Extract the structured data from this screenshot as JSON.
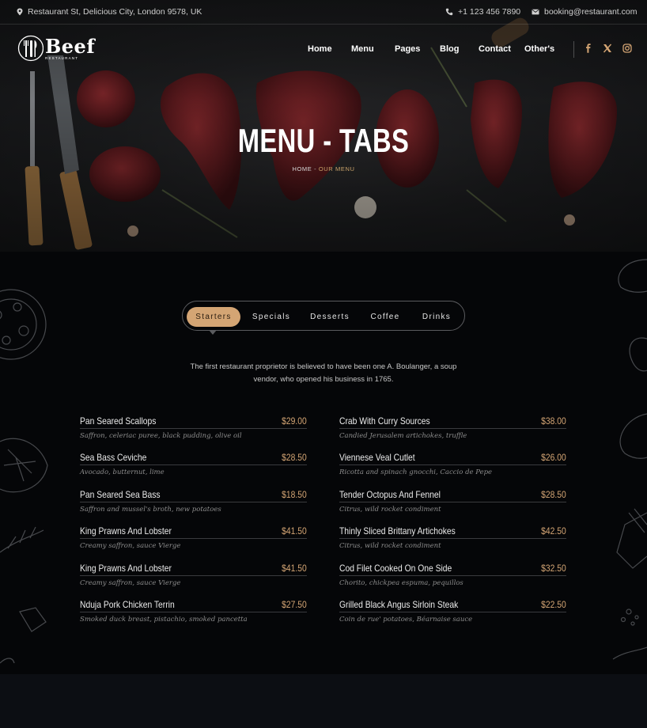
{
  "topbar": {
    "address": "Restaurant St, Delicious City, London 9578, UK",
    "phone": "+1 123 456 7890",
    "email": "booking@restaurant.com",
    "icons": [
      "map-pin-icon",
      "phone-icon",
      "envelope-icon"
    ]
  },
  "logo": {
    "name": "Beef",
    "tagline": "RESTAURANT"
  },
  "nav": {
    "items": [
      "Home",
      "Menu",
      "Pages",
      "Blog",
      "Contact",
      "Other's"
    ]
  },
  "social": {
    "icons": [
      "facebook-icon",
      "x-twitter-icon",
      "instagram-icon"
    ]
  },
  "hero": {
    "title": "MENU - TABS",
    "breadcrumb_home": "HOME",
    "breadcrumb_sep": " - ",
    "breadcrumb_current": "OUR MENU"
  },
  "tabs": {
    "items": [
      "Starters",
      "Specials",
      "Desserts",
      "Coffee",
      "Drinks"
    ],
    "active": "Starters"
  },
  "intro": "The first restaurant proprietor is believed to have been one A. Boulanger, a soup vendor, who opened his business in 1765.",
  "menu": {
    "left": [
      {
        "name": "Pan Seared Scallops",
        "price": "$29.00",
        "desc": "Saffron, celeriac puree, black pudding, olive oil"
      },
      {
        "name": "Sea Bass Ceviche",
        "price": "$28.50",
        "desc": "Avocado, butternut, lime"
      },
      {
        "name": "Pan Seared Sea Bass",
        "price": "$18.50",
        "desc": "Saffron and mussel's broth, new potatoes"
      },
      {
        "name": "King Prawns And Lobster",
        "price": "$41.50",
        "desc": "Creamy saffron, sauce Vierge"
      },
      {
        "name": "King Prawns And Lobster",
        "price": "$41.50",
        "desc": "Creamy saffron, sauce Vierge"
      },
      {
        "name": "Nduja Pork Chicken Terrin",
        "price": "$27.50",
        "desc": "Smoked duck breast, pistachio, smoked pancetta"
      }
    ],
    "right": [
      {
        "name": "Crab With Curry Sources",
        "price": "$38.00",
        "desc": "Candied Jerusalem artichokes, truffle"
      },
      {
        "name": "Viennese Veal Cutlet",
        "price": "$26.00",
        "desc": "Ricotta and spinach gnocchi, Caccio de Pepe"
      },
      {
        "name": "Tender Octopus And Fennel",
        "price": "$28.50",
        "desc": "Citrus, wild rocket condiment"
      },
      {
        "name": "Thinly Sliced Brittany Artichokes",
        "price": "$42.50",
        "desc": "Citrus, wild rocket condiment"
      },
      {
        "name": "Cod Filet Cooked On One Side",
        "price": "$32.50",
        "desc": "Chorito, chickpea espuma, pequillos"
      },
      {
        "name": "Grilled Black Angus Sirloin Steak",
        "price": "$22.50",
        "desc": "Coin de rue' potatoes, Béarnaise sauce"
      }
    ]
  },
  "colors": {
    "accent": "#d4a574",
    "background": "#050608",
    "hero": "#1e1f21"
  }
}
